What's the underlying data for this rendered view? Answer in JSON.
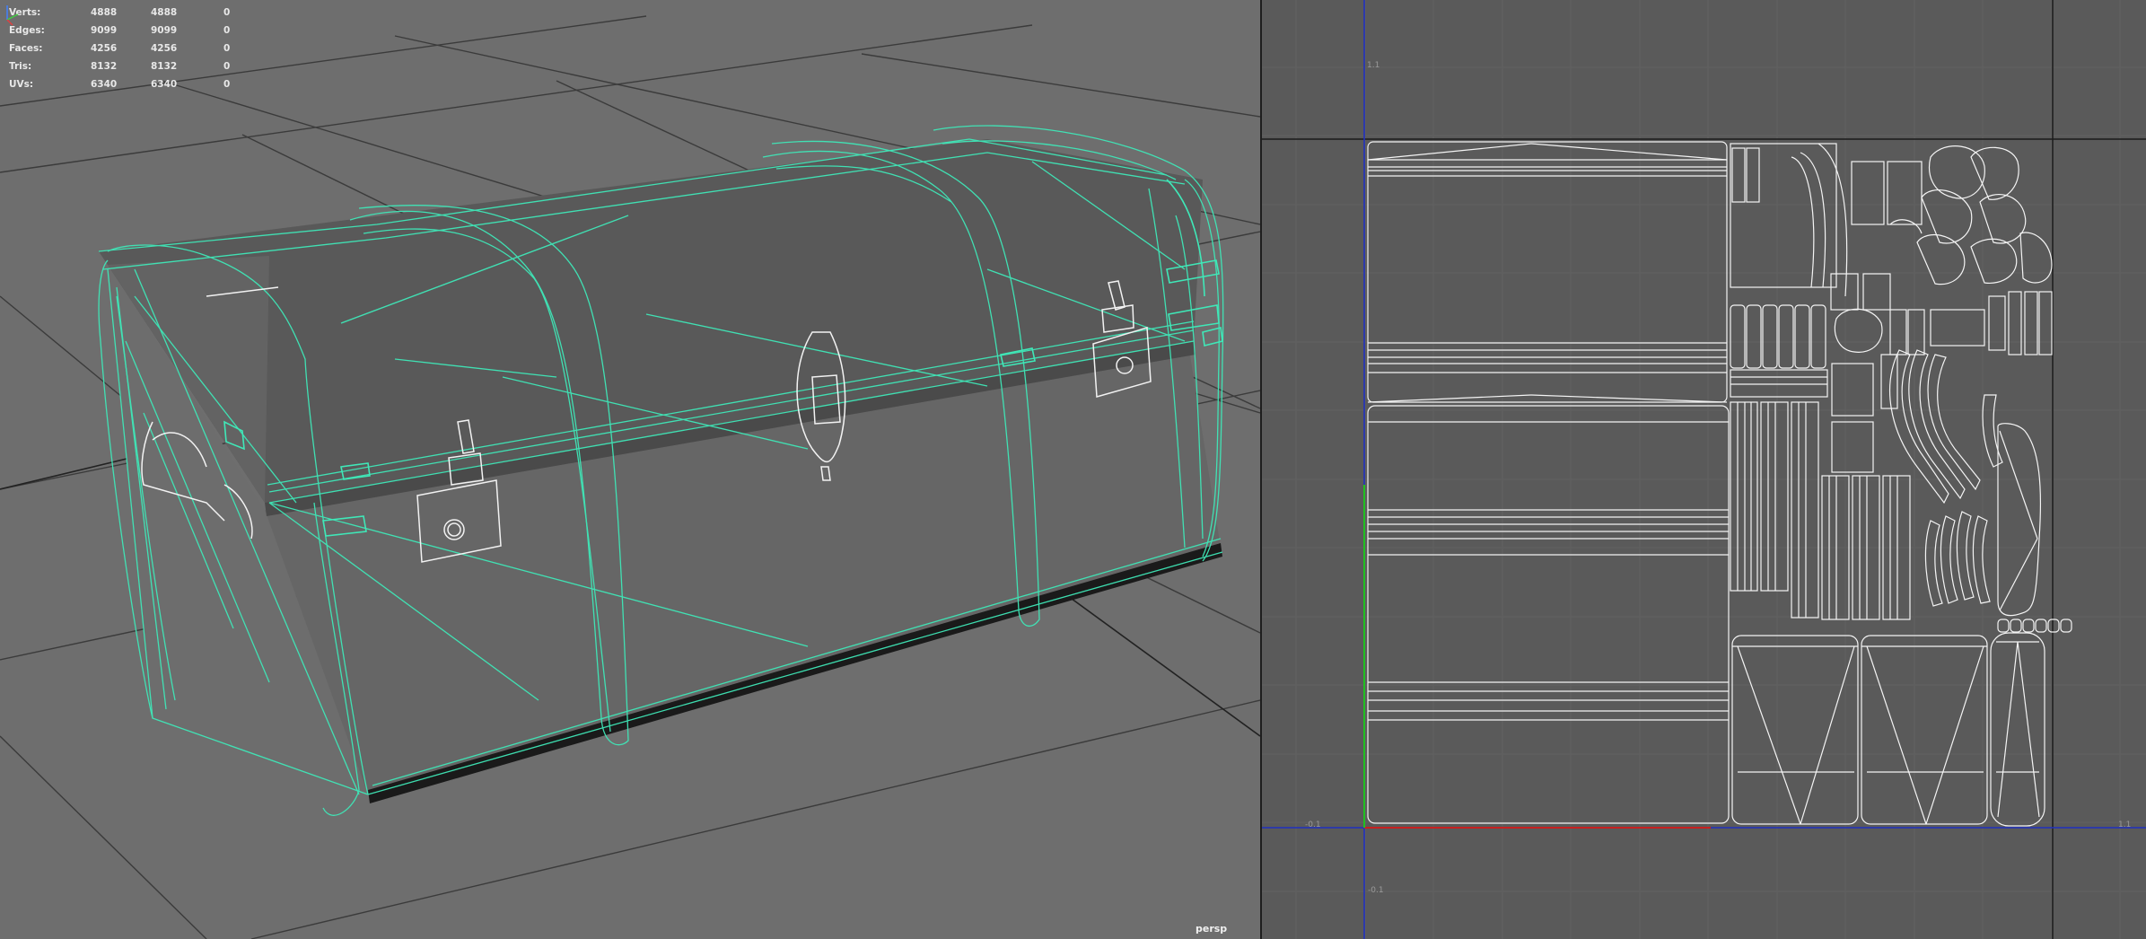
{
  "viewport": {
    "camera_label": "persp",
    "hud": [
      {
        "label": "Verts:",
        "values": [
          "4888",
          "4888",
          "0"
        ]
      },
      {
        "label": "Edges:",
        "values": [
          "9099",
          "9099",
          "0"
        ]
      },
      {
        "label": "Faces:",
        "values": [
          "4256",
          "4256",
          "0"
        ]
      },
      {
        "label": "Tris:",
        "values": [
          "8132",
          "8132",
          "0"
        ]
      },
      {
        "label": "UVs:",
        "values": [
          "6340",
          "6340",
          "0"
        ]
      }
    ],
    "wireframe_color": "#3fe8b8"
  },
  "uv_editor": {
    "grid_labels": {
      "x_neg": "-0.1",
      "x_pos": "1.1",
      "y_pos": "1.1",
      "y_neg": "-0.1"
    },
    "u_axis_color": "#c82020",
    "v_axis_color": "#20c020",
    "frame_color": "#2030c0"
  }
}
